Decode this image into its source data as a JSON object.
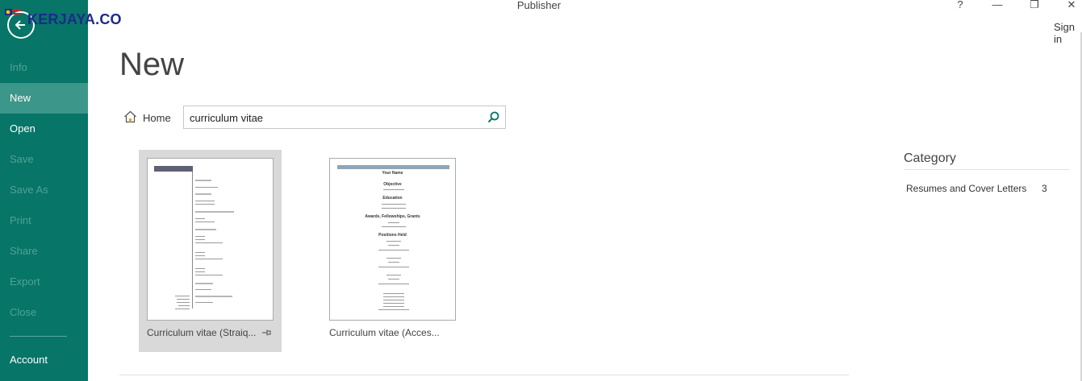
{
  "window": {
    "title": "Publisher",
    "help_label": "?",
    "minimize_label": "—",
    "restore_label": "❐",
    "close_label": "✕",
    "sign_in": "Sign in"
  },
  "watermark": {
    "text": "KERJAYA.CO"
  },
  "sidebar": {
    "items": [
      {
        "label": "Info",
        "state": "disabled"
      },
      {
        "label": "New",
        "state": "active"
      },
      {
        "label": "Open",
        "state": "enabled"
      },
      {
        "label": "Save",
        "state": "disabled"
      },
      {
        "label": "Save As",
        "state": "disabled"
      },
      {
        "label": "Print",
        "state": "disabled"
      },
      {
        "label": "Share",
        "state": "disabled"
      },
      {
        "label": "Export",
        "state": "disabled"
      },
      {
        "label": "Close",
        "state": "disabled"
      }
    ],
    "account": "Account"
  },
  "main": {
    "title": "New",
    "home_label": "Home",
    "search": {
      "value": "curriculum vitae"
    },
    "templates": [
      {
        "name": "Curriculum vitae (Straiq...",
        "selected": true
      },
      {
        "name": "Curriculum vitae (Acces...",
        "selected": false
      }
    ]
  },
  "template_preview": {
    "t1_headings": [
      "Objective",
      "Education",
      "Awards, Fellowships, Grants",
      "Positions Held",
      "Publications",
      "Conference Presentations"
    ],
    "t2_name": "Your Name",
    "t2_headings": [
      "Objective",
      "Education",
      "Awards, Fellowships, Grants",
      "Positions Held"
    ]
  },
  "category": {
    "title": "Category",
    "items": [
      {
        "label": "Resumes and Cover Letters",
        "count": "3"
      }
    ]
  },
  "colors": {
    "sidebar_bg": "#077568",
    "sidebar_active": "#3c9689",
    "sidebar_disabled_text": "#4fa397",
    "selected_tile": "#d9d9d9",
    "search_icon": "#077568"
  }
}
